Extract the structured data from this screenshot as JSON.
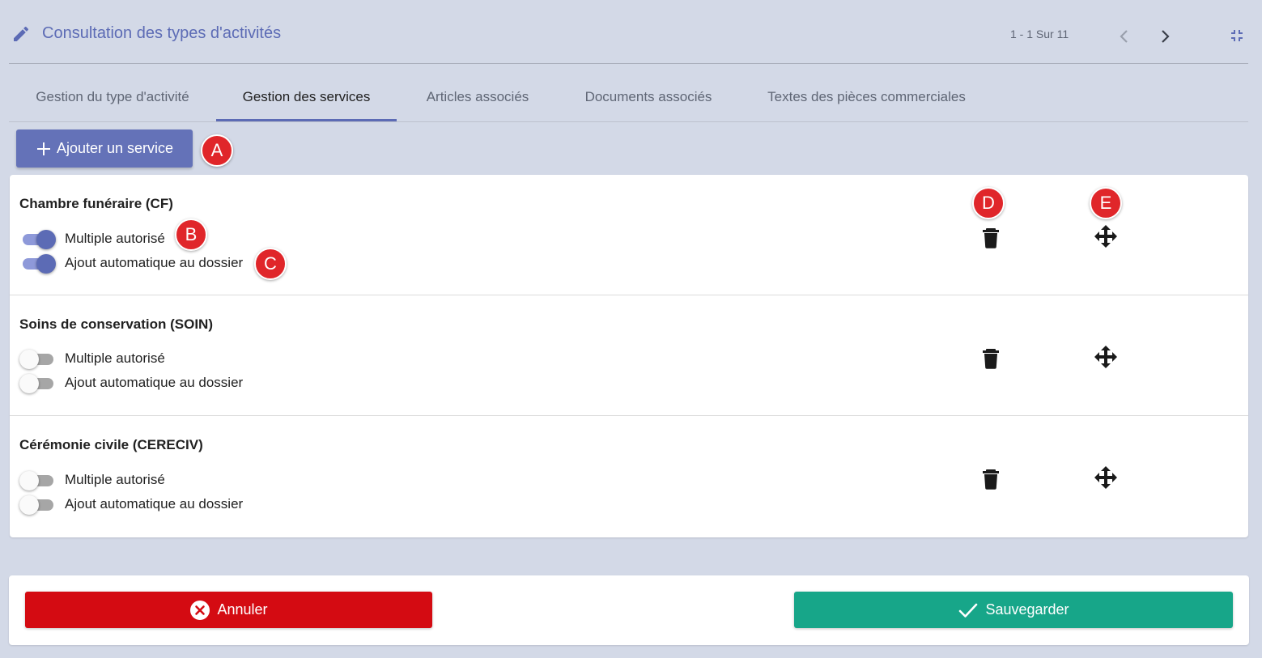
{
  "header": {
    "title": "Consultation des types d'activités",
    "pager": "1 - 1 Sur 11",
    "accent_color": "#5c6bb5"
  },
  "tabs": [
    {
      "label": "Gestion du type d'activité",
      "active": false
    },
    {
      "label": "Gestion des services",
      "active": true
    },
    {
      "label": "Articles associés",
      "active": false
    },
    {
      "label": "Documents associés",
      "active": false
    },
    {
      "label": "Textes des pièces commerciales",
      "active": false
    }
  ],
  "add_button": {
    "label": "Ajouter un service",
    "icon": "plus-icon"
  },
  "markers": [
    "A",
    "B",
    "C",
    "D",
    "E"
  ],
  "services": [
    {
      "name": "Chambre funéraire (CF)",
      "multiple_label": "Multiple autorisé",
      "multiple": true,
      "auto_label": "Ajout automatique au dossier",
      "auto": true
    },
    {
      "name": "Soins de conservation (SOIN)",
      "multiple_label": "Multiple autorisé",
      "multiple": false,
      "auto_label": "Ajout automatique au dossier",
      "auto": false
    },
    {
      "name": "Cérémonie civile (CERECIV)",
      "multiple_label": "Multiple autorisé",
      "multiple": false,
      "auto_label": "Ajout automatique au dossier",
      "auto": false
    }
  ],
  "row_icons": {
    "delete": "trash-icon",
    "move": "move-arrows-icon"
  },
  "footer": {
    "cancel_label": "Annuler",
    "cancel_color": "#d40b12",
    "save_label": "Sauvegarder",
    "save_color": "#17a689"
  }
}
